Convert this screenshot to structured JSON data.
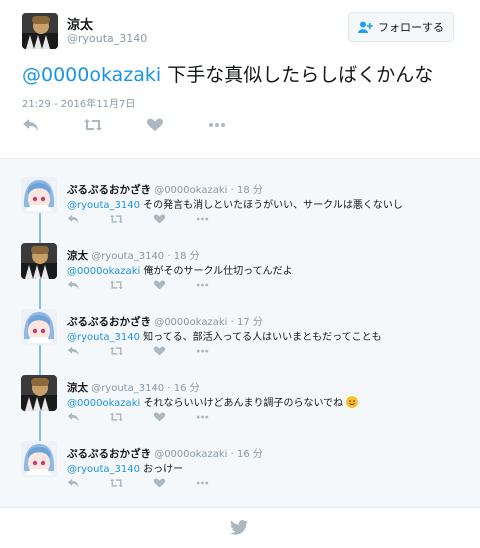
{
  "main_tweet": {
    "name": "涼太",
    "handle": "@ryouta_3140",
    "follow_label": "フォローする",
    "mention": "@0000okazaki",
    "text": " 下手な真似したらしばくかんな",
    "timestamp": "21:29 - 2016年11月7日"
  },
  "replies": [
    {
      "name": "ぷるぷるおかざき",
      "handle": "@0000okazaki",
      "time": "18 分",
      "mention": "@ryouta_3140",
      "text": " その発言も消しといたほうがいい、サークルは悪くないし"
    },
    {
      "name": "涼太",
      "handle": "@ryouta_3140",
      "time": "18 分",
      "mention": "@0000okazaki",
      "text": " 俺がそのサークル仕切ってんだよ"
    },
    {
      "name": "ぷるぷるおかざき",
      "handle": "@0000okazaki",
      "time": "17 分",
      "mention": "@ryouta_3140",
      "text": " 知ってる、部活入ってる人はいいまともだってことも"
    },
    {
      "name": "涼太",
      "handle": "@ryouta_3140",
      "time": "16 分",
      "mention": "@0000okazaki",
      "text": " それならいいけどあんまり調子のらないでね"
    },
    {
      "name": "ぷるぷるおかざき",
      "handle": "@0000okazaki",
      "time": "16 分",
      "mention": "@ryouta_3140",
      "text": " おっけー"
    }
  ],
  "meta": {
    "separator": "·"
  },
  "colors": {
    "link": "#1b95e0",
    "muted": "#8899a6",
    "thread_line": "#7fbfe0",
    "icon": "#aab8c2"
  },
  "icons": [
    "reply-icon",
    "retweet-icon",
    "like-icon",
    "more-icon",
    "follow-person-icon",
    "twitter-bird-icon"
  ]
}
